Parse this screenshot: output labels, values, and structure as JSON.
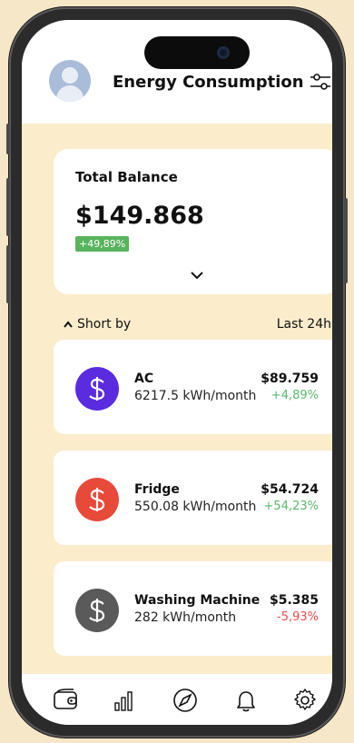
{
  "header": {
    "title": "Energy Consumption"
  },
  "balance": {
    "label": "Total Balance",
    "amount": "$149.868",
    "change": "+49,89%"
  },
  "sort": {
    "left_label": "Short by",
    "right_label": "Last 24h"
  },
  "items": [
    {
      "name": "AC",
      "usage": "6217.5 kWh/month",
      "amount": "$89.759",
      "change": "+4,89%",
      "change_color": "#5ab86c",
      "icon_color": "#5b2be0"
    },
    {
      "name": "Fridge",
      "usage": "550.08 kWh/month",
      "amount": "$54.724",
      "change": "+54,23%",
      "change_color": "#5ab86c",
      "icon_color": "#e84a3a"
    },
    {
      "name": "Washing Machine",
      "usage": "282 kWh/month",
      "amount": "$5.385",
      "change": "-5,93%",
      "change_color": "#e34b4b",
      "icon_color": "#5a5a5a"
    }
  ],
  "nav": [
    {
      "name": "wallet-icon"
    },
    {
      "name": "bar-chart-icon"
    },
    {
      "name": "compass-icon"
    },
    {
      "name": "bell-icon"
    },
    {
      "name": "gear-icon"
    }
  ]
}
